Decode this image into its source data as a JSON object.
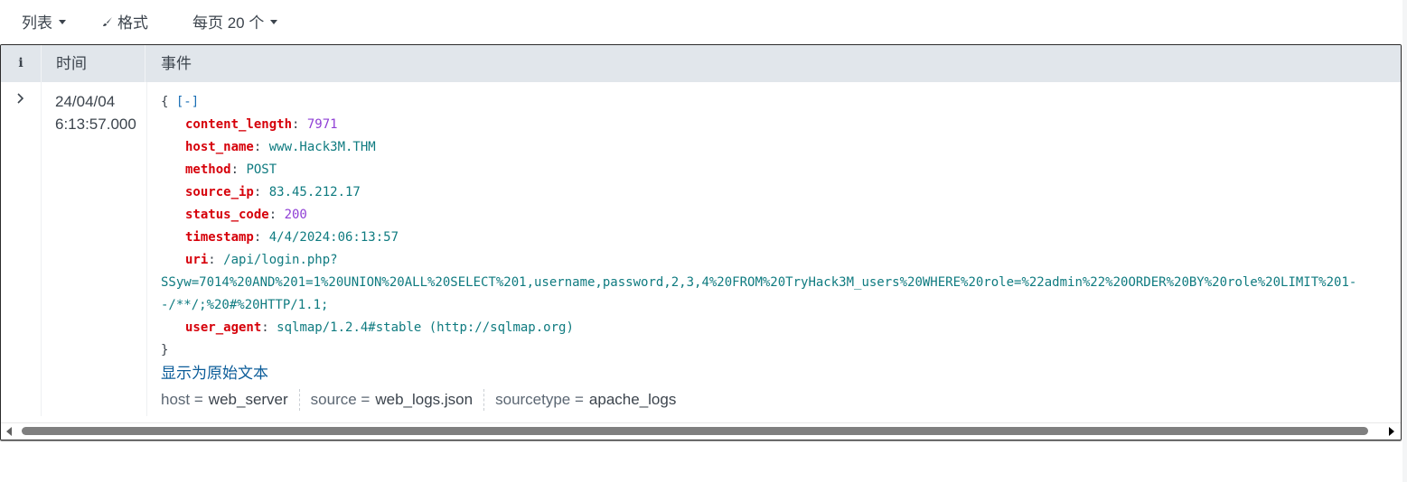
{
  "toolbar": {
    "list_label": "列表",
    "format_label": "格式",
    "per_page_label": "每页 20 个"
  },
  "table": {
    "headers": {
      "info": "i",
      "time": "时间",
      "event": "事件"
    }
  },
  "event": {
    "time_date": "24/04/04",
    "time_clock": "6:13:57.000",
    "open_brace": "{",
    "collapse_toggle": "[-]",
    "close_brace": "}",
    "fields": [
      {
        "key": "content_length",
        "value": "7971",
        "kind": "num"
      },
      {
        "key": "host_name",
        "value": "www.Hack3M.THM",
        "kind": "str"
      },
      {
        "key": "method",
        "value": "POST",
        "kind": "str"
      },
      {
        "key": "source_ip",
        "value": "83.45.212.17",
        "kind": "str"
      },
      {
        "key": "status_code",
        "value": "200",
        "kind": "num"
      },
      {
        "key": "timestamp",
        "value": "4/4/2024:06:13:57",
        "kind": "str"
      }
    ],
    "uri": {
      "key": "uri",
      "line1": "/api/login.php?",
      "line2": "SSyw=7014%20AND%201=1%20UNION%20ALL%20SELECT%201,username,password,2,3,4%20FROM%20TryHack3M_users%20WHERE%20role=%22admin%22%20ORDER%20BY%20role%20LIMIT%201-",
      "line3": "-/**/;%20#%20HTTP/1.1;"
    },
    "user_agent": {
      "key": "user_agent",
      "value": "sqlmap/1.2.4#stable (http://sqlmap.org)"
    },
    "show_raw_label": "显示为原始文本",
    "meta_fields": [
      {
        "name": "host =",
        "value": "web_server"
      },
      {
        "name": "source =",
        "value": "web_logs.json"
      },
      {
        "name": "sourcetype =",
        "value": "apache_logs"
      }
    ]
  },
  "colors": {
    "key": "#d6000a",
    "number": "#8f3fd5",
    "string": "#0f7b80",
    "link": "#0b5c99",
    "header_bg": "#e1e6eb"
  }
}
